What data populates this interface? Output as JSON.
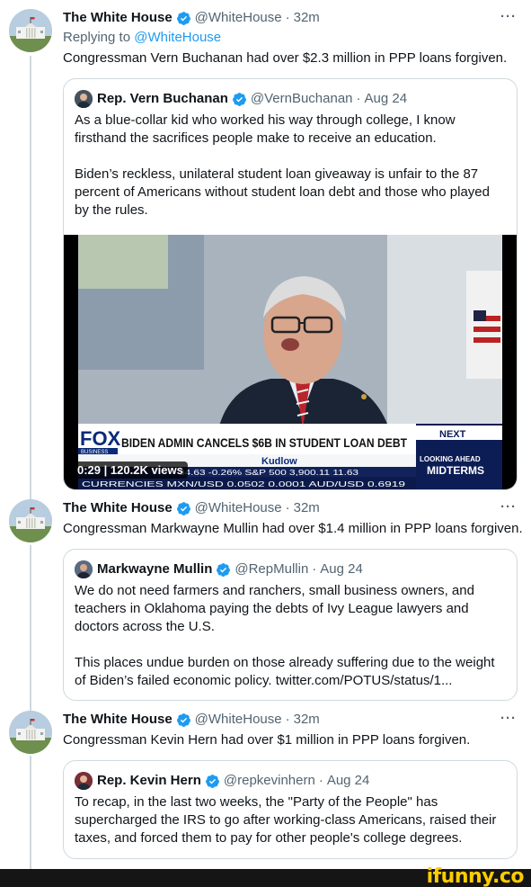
{
  "colors": {
    "link": "#1d9bf0",
    "verified": "#1d9bf0",
    "secondary": "#536471",
    "border": "#cfd9de",
    "ifunny": "#ffcc00"
  },
  "tweets": [
    {
      "name": "The White House",
      "handle": "@WhiteHouse",
      "time": "32m",
      "more": "···",
      "replying_prefix": "Replying to",
      "replying_handle": "@WhiteHouse",
      "text": "Congressman Vern Buchanan had over $2.3 million in PPP loans forgiven.",
      "quote": {
        "name": "Rep. Vern Buchanan",
        "handle": "@VernBuchanan",
        "date": "Aug 24",
        "paragraphs": [
          "As a blue-collar kid who worked his way through college, I know firsthand the sacrifices people make to receive an education.",
          "Biden’s reckless, unilateral student loan giveaway is unfair to the 87 percent of Americans without student loan debt and those who played by the rules."
        ],
        "video": {
          "duration": "0:29",
          "views": "120.2K views",
          "network": "FOX",
          "network_sub": "BUSINESS",
          "headline": "BIDEN ADMIN CANCELS $6B IN STUDENT LOAN DEBT",
          "show": "Kudlow",
          "next_label": "NEXT",
          "promo_line1": "LOOKING AHEAD",
          "promo_line2": "MIDTERMS",
          "ticker": "CURRENCIES   MXN/USD  0.0502  0.0001   AUD/USD  0.6919",
          "ticker_top": "34.63  -0.26%   S&P 500   3,900.11   11.63"
        }
      }
    },
    {
      "name": "The White House",
      "handle": "@WhiteHouse",
      "time": "32m",
      "more": "···",
      "text": "Congressman Markwayne Mullin had over $1.4 million in PPP loans forgiven.",
      "quote": {
        "name": "Markwayne Mullin",
        "handle": "@RepMullin",
        "date": "Aug 24",
        "paragraphs": [
          "We do not need farmers and ranchers, small business owners, and teachers in Oklahoma paying the debts of Ivy League lawyers and doctors across the U.S.",
          "This places undue burden on those already suffering due to the weight of Biden’s failed economic policy. twitter.com/POTUS/status/1..."
        ]
      }
    },
    {
      "name": "The White House",
      "handle": "@WhiteHouse",
      "time": "32m",
      "more": "···",
      "text": "Congressman Kevin Hern had over $1 million in PPP loans forgiven.",
      "quote": {
        "name": "Rep. Kevin Hern",
        "handle": "@repkevinhern",
        "date": "Aug 24",
        "paragraphs": [
          "To recap, in the last two weeks, the \"Party of the People\" has supercharged the IRS to go after working-class Americans, raised their taxes, and forced them to pay for other people's college degrees."
        ]
      }
    }
  ],
  "watermark": "ifunny.co"
}
